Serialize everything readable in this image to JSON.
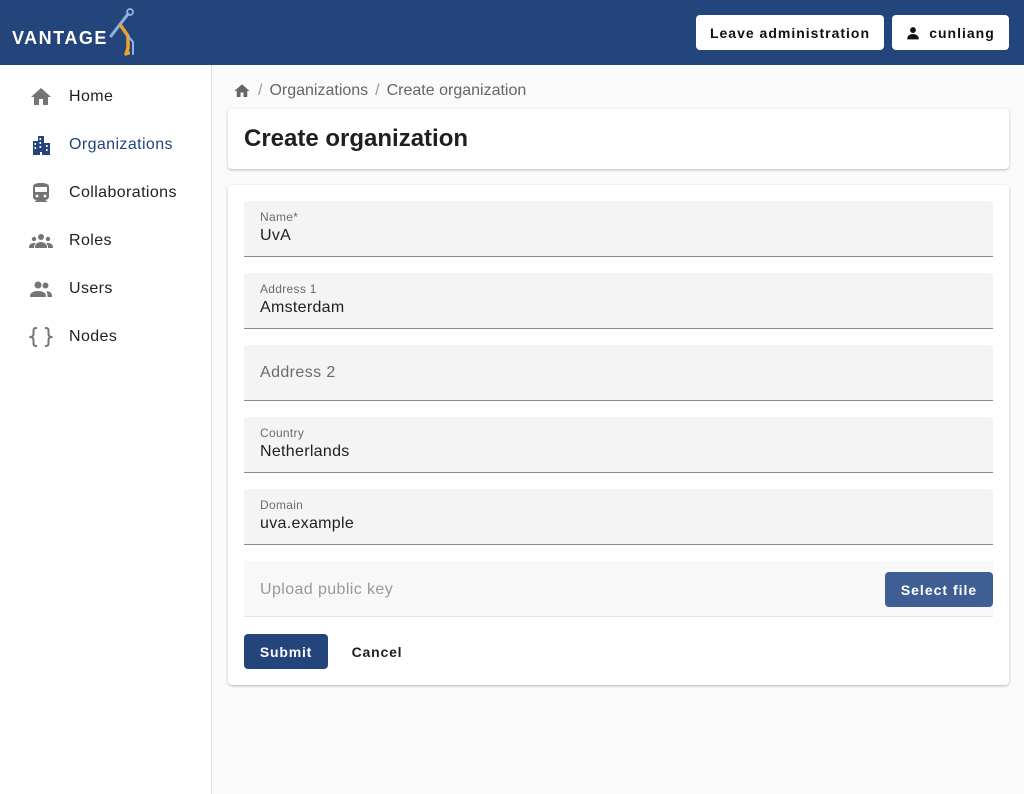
{
  "header": {
    "logo_text": "VANTAGE",
    "leave_admin_label": "Leave administration",
    "username": "cunliang"
  },
  "sidebar": {
    "items": [
      {
        "label": "Home",
        "icon": "home-icon"
      },
      {
        "label": "Organizations",
        "icon": "organization-building-icon",
        "active": true
      },
      {
        "label": "Collaborations",
        "icon": "train-icon"
      },
      {
        "label": "Roles",
        "icon": "group-icon"
      },
      {
        "label": "Users",
        "icon": "people-icon"
      },
      {
        "label": "Nodes",
        "icon": "curly-braces-icon"
      }
    ]
  },
  "breadcrumb": {
    "items": [
      "Organizations",
      "Create organization"
    ]
  },
  "page": {
    "title": "Create organization"
  },
  "form": {
    "name": {
      "label": "Name*",
      "value": "UvA"
    },
    "address1": {
      "label": "Address 1",
      "value": "Amsterdam"
    },
    "address2": {
      "placeholder": "Address 2"
    },
    "country": {
      "label": "Country",
      "value": "Netherlands"
    },
    "domain": {
      "label": "Domain",
      "value": "uva.example"
    },
    "public_key": {
      "placeholder": "Upload public key",
      "button_label": "Select file"
    },
    "submit_label": "Submit",
    "cancel_label": "Cancel"
  },
  "colors": {
    "primary": "#23457c",
    "secondary_button": "#3f5e93",
    "logo_accent_orange": "#f0a12c",
    "logo_accent_blue": "#8fb3e0"
  }
}
